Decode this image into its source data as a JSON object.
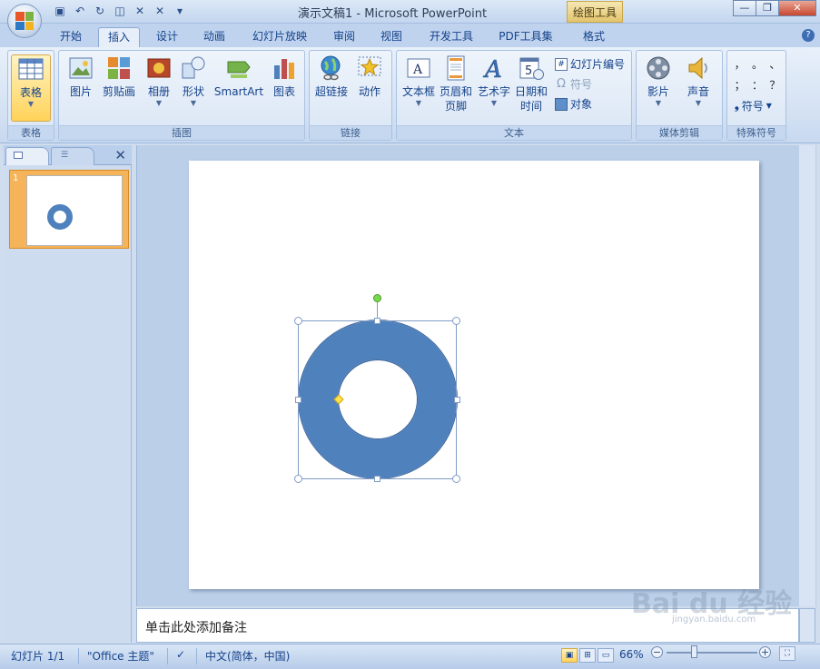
{
  "title_bar": {
    "title": "演示文稿1 - Microsoft PowerPoint",
    "context_tab": "绘图工具",
    "qat_icons": [
      "save-icon",
      "undo-icon",
      "redo-icon",
      "preview-icon",
      "x-icon",
      "x-icon",
      "customize-icon"
    ]
  },
  "tabs": [
    "开始",
    "插入",
    "设计",
    "动画",
    "幻灯片放映",
    "审阅",
    "视图",
    "开发工具",
    "PDF工具集",
    "格式"
  ],
  "active_tab": "插入",
  "ribbon": {
    "groups": {
      "table": "表格",
      "illustrations": "插图",
      "links": "链接",
      "text": "文本",
      "media": "媒体剪辑",
      "special_symbols": "特殊符号"
    },
    "buttons": {
      "table": "表格",
      "picture": "图片",
      "clipart": "剪贴画",
      "album": "相册",
      "shapes": "形状",
      "smartart": "SmartArt",
      "chart": "图表",
      "hyperlink": "超链接",
      "action": "动作",
      "textbox": "文本框",
      "header_footer_1": "页眉和",
      "header_footer_2": "页脚",
      "wordart": "艺术字",
      "datetime_1": "日期和",
      "datetime_2": "时间",
      "datetime_digit": "5",
      "slide_number": "幻灯片编号",
      "symbol": "符号",
      "object": "对象",
      "movie": "影片",
      "sound": "声音",
      "symbols_menu": "符号"
    },
    "special_marks": [
      "，",
      "。",
      "、",
      "；",
      "：",
      "？"
    ]
  },
  "slide_panel": {
    "slide_number": "1"
  },
  "notes": {
    "placeholder": "单击此处添加备注"
  },
  "status": {
    "slide_info": "幻灯片 1/1",
    "theme": "\"Office 主题\"",
    "language": "中文(简体，中国)",
    "zoom": "66%"
  },
  "watermark": {
    "text": "Bai du 经验",
    "sub": "jingyan.baidu.com"
  },
  "colors": {
    "shape_fill": "#4f81bd",
    "ribbon_bg": "#dae6f5",
    "accent_orange": "#f6b45a"
  }
}
